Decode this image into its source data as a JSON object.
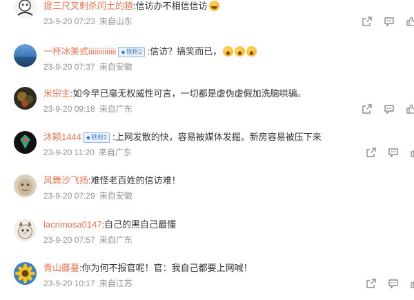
{
  "comments": [
    {
      "username": "提三尺叉剌杀闰土的猹",
      "text": "信访办不相信信访",
      "emojis": [
        "grin"
      ],
      "time": "23-9-20 07:23",
      "location": "来自山东",
      "actions": [
        "share-icon",
        "comment-icon",
        "like-icon"
      ]
    },
    {
      "username": "一杯冰美式iiiiiiiiiiiiii",
      "badge": "铁粉2",
      "text": "信访？搞笑而已，",
      "emojis": [
        "gasp",
        "gasp",
        "gasp"
      ],
      "time": "23-9-20 07:37",
      "location": "来自安徽"
    },
    {
      "username": "米宗主",
      "text": "如今早已毫无权威性可言，一切都是虚伪虚假加洗脑哄骗。",
      "time": "23-9-20 09:18",
      "location": "来自广东"
    },
    {
      "username": "沐颖1444",
      "badge": "铁粉2",
      "text": "上网发散的快，容易被媒体发掘。新房容易被压下来",
      "time": "23-9-20 11:20",
      "location": "来自广东"
    },
    {
      "username": "风舞沙飞扬",
      "text": "难怪老百姓的信访难！",
      "time": "23-9-20 07:29",
      "location": "来自安徽"
    },
    {
      "username": "lacrimosa0147",
      "text": "自己的黑自己最懂",
      "time": "23-9-20 07:57",
      "location": "来自广东"
    },
    {
      "username": "青山藤蔓",
      "text": "你为何不报官呢！官：我自己都要上网喊！",
      "time": "23-9-20 10:17",
      "location": "来自江苏"
    }
  ],
  "colors": {
    "username": "#eb7350",
    "text": "#333333",
    "meta": "#939393",
    "icon": "#8c8c8c",
    "badge": "#4a7fd0"
  }
}
